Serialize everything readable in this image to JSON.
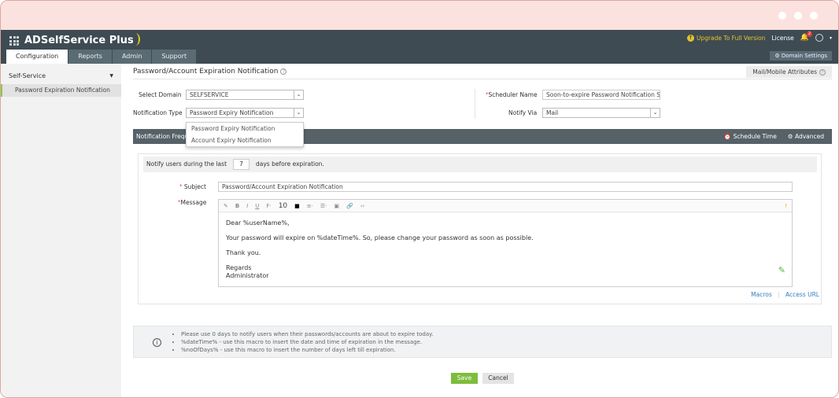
{
  "app": {
    "name": "ADSelfService Plus",
    "tabs": [
      "Configuration",
      "Reports",
      "Admin",
      "Support"
    ],
    "upgrade": "Upgrade To Full Version",
    "license": "License",
    "notifications": "2",
    "domain_settings": "Domain Settings"
  },
  "sidebar": {
    "section": "Self-Service",
    "items": [
      "Password Expiration Notification"
    ]
  },
  "page": {
    "title": "Password/Account Expiration Notification",
    "mail_attr": "Mail/Mobile Attributes"
  },
  "form": {
    "select_domain_label": "Select Domain",
    "select_domain_value": "SELFSERVICE",
    "notif_type_label": "Notification Type",
    "notif_type_value": "Password Expiry Notification",
    "notif_type_options": [
      "Password Expiry Notification",
      "Account Expiry Notification"
    ],
    "scheduler_label": "Scheduler Name",
    "scheduler_value": "Soon-to-expire Password Notification Scl",
    "notify_via_label": "Notify Via",
    "notify_via_value": "Mail"
  },
  "bar": {
    "title": "Notification Frequency",
    "schedule": "Schedule Time",
    "advanced": "Advanced"
  },
  "notify": {
    "prefix": "Notify users during the last",
    "days": "7",
    "suffix": "days before expiration."
  },
  "subject": {
    "label": "Subject",
    "value": "Password/Account Expiration Notification"
  },
  "message": {
    "label": "Message",
    "font_size": "10",
    "lines": [
      "Dear %userName%,",
      "Your password will expire on %dateTime%. So, please change your password as soon as possible.",
      "Thank you.",
      "Regards",
      "Administrator"
    ]
  },
  "links": {
    "macros": "Macros",
    "access_url": "Access URL"
  },
  "info": [
    "Please use 0 days to notify users when their passwords/accounts are about to expire today.",
    "%dateTime% - use this macro to insert the date and time of expiration in the message.",
    "%noOfDays% - use this macro to insert the number of days left till expiration."
  ],
  "buttons": {
    "save": "Save",
    "cancel": "Cancel"
  },
  "colors": {
    "header": "#3e4b53",
    "save": "#7dbd3c",
    "link": "#2f7ec1"
  }
}
